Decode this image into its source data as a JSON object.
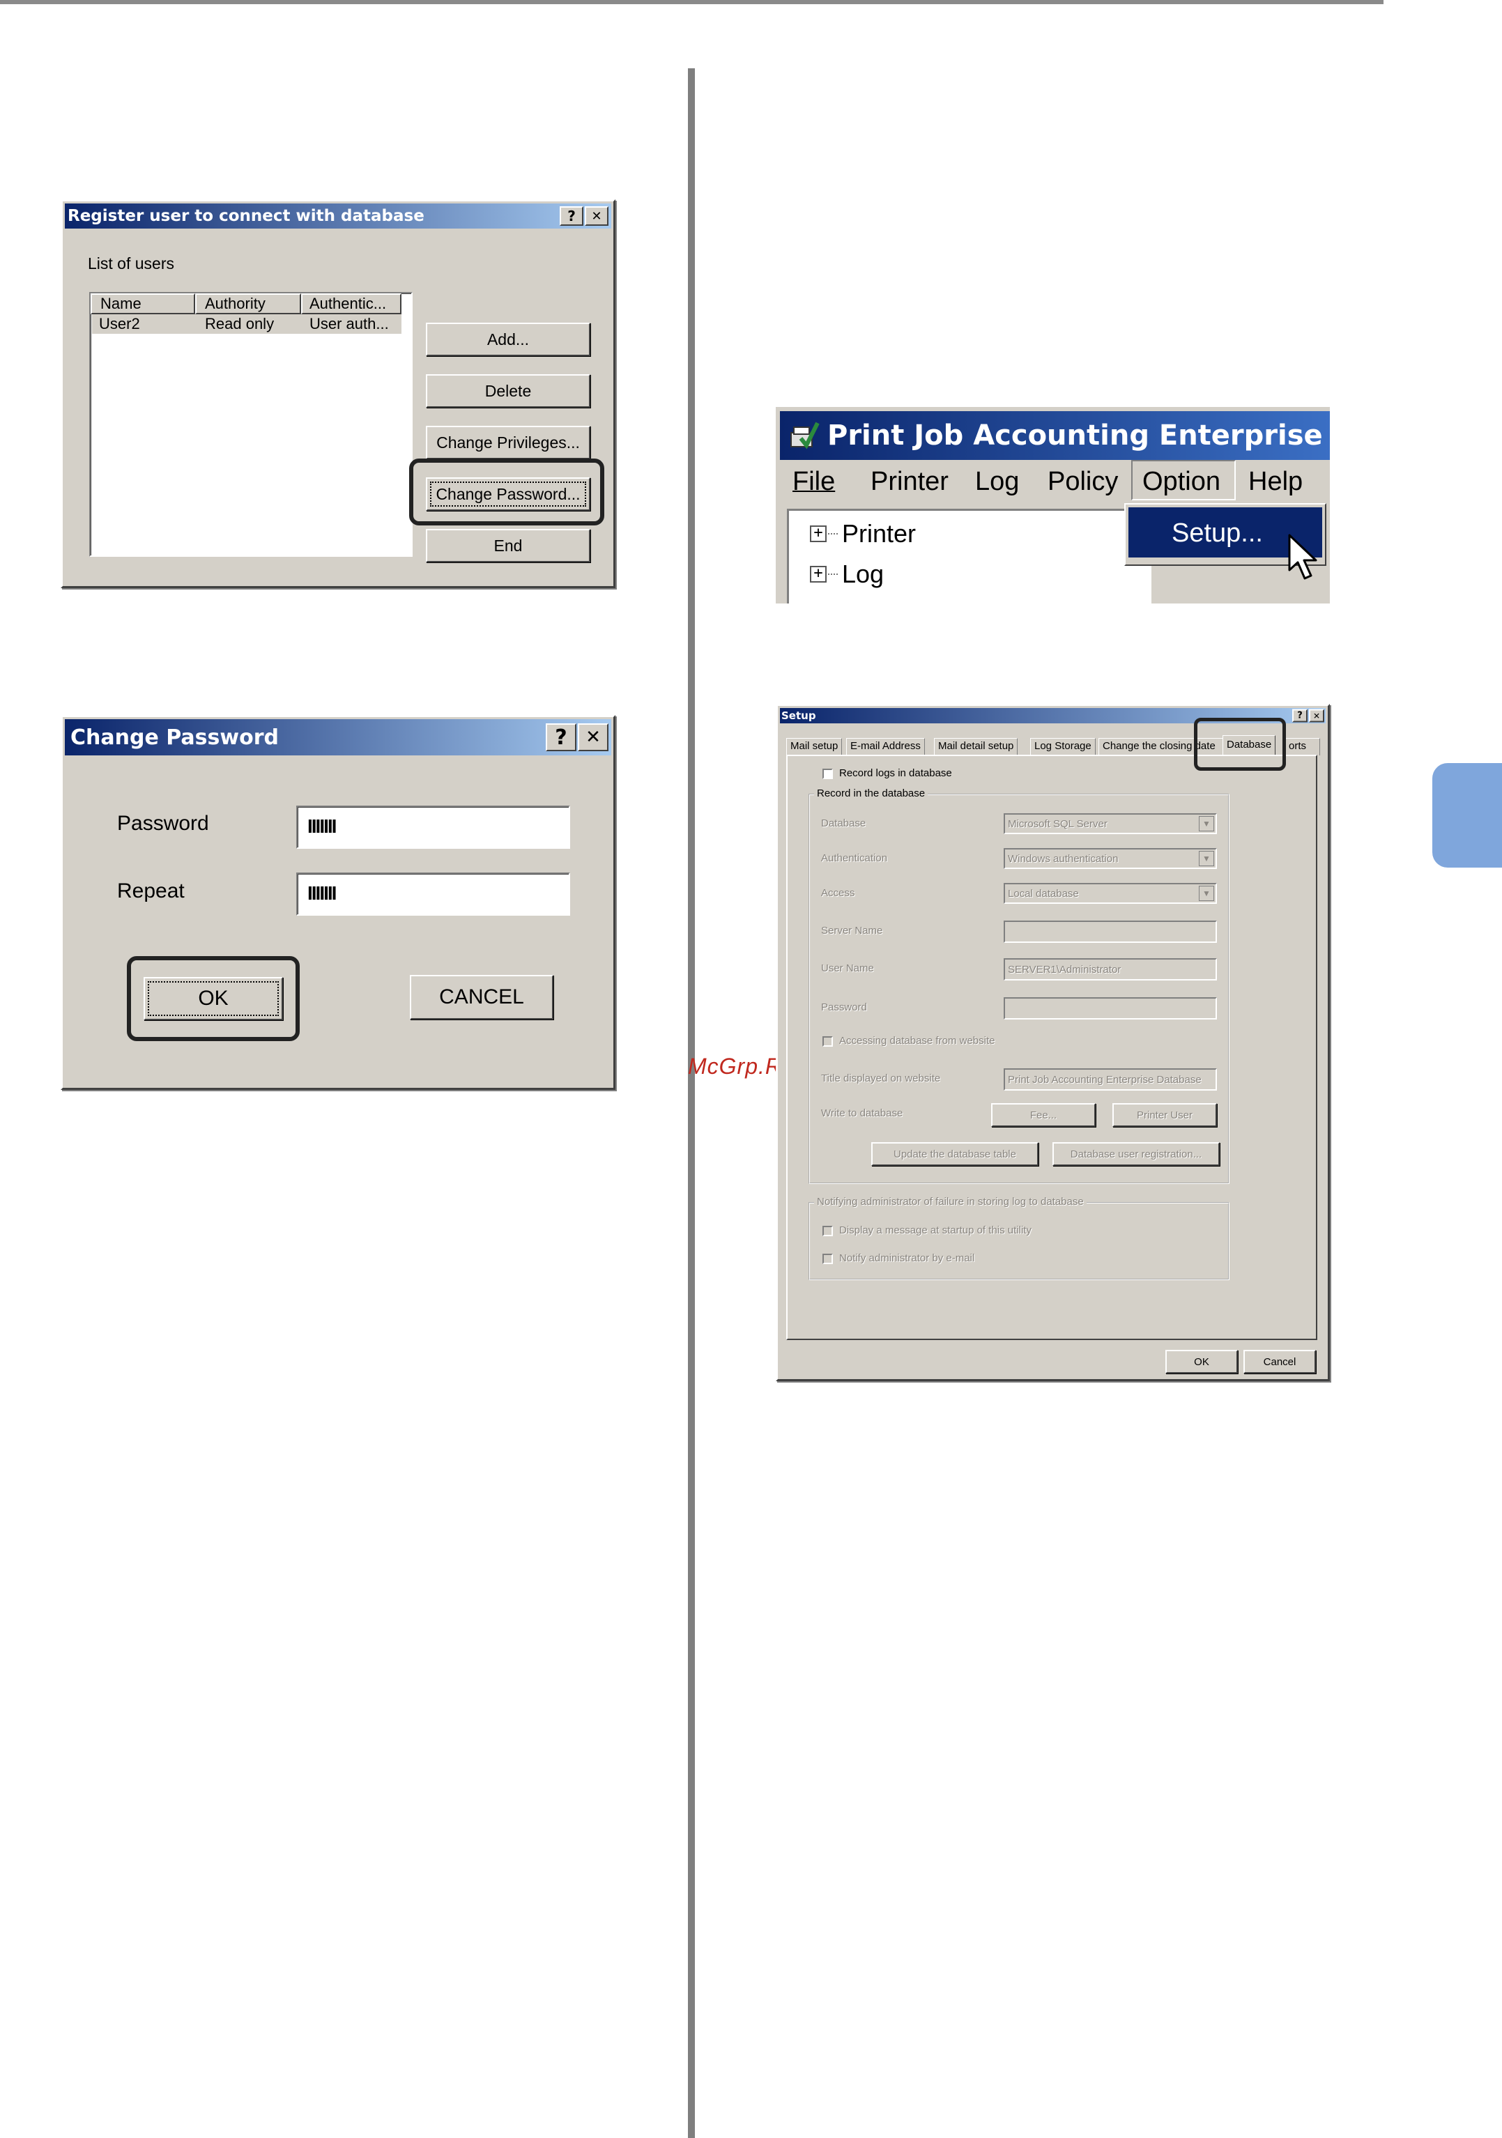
{
  "register_dialog": {
    "title": "Register user to connect with database",
    "help_glyph": "?",
    "close_glyph": "✕",
    "list_label": "List of users",
    "columns": [
      "Name",
      "Authority",
      "Authentic..."
    ],
    "rows": [
      {
        "name": "User2",
        "authority": "Read only",
        "auth": "User auth..."
      }
    ],
    "buttons": {
      "add": "Add...",
      "delete": "Delete",
      "change_privileges": "Change Privileges...",
      "change_password": "Change Password...",
      "end": "End"
    }
  },
  "change_password_dialog": {
    "title": "Change Password",
    "help_glyph": "?",
    "close_glyph": "✕",
    "password_label": "Password",
    "password_value": "IIIIIII",
    "repeat_label": "Repeat",
    "repeat_value": "IIIIIII",
    "ok": "OK",
    "cancel": "CANCEL"
  },
  "app_window": {
    "title": "Print Job Accounting Enterprise",
    "app_icon": "printer-check-icon",
    "menu": [
      "File",
      "Printer",
      "Log",
      "Policy",
      "Option",
      "Help"
    ],
    "tree": [
      "Printer",
      "Log"
    ],
    "expand_glyph": "+",
    "dropdown_item": "Setup...",
    "cursor_icon": "mouse-pointer-icon"
  },
  "setup_dialog": {
    "title": "Setup",
    "help_glyph": "?",
    "close_glyph": "✕",
    "tabs": [
      "Mail setup",
      "E-mail Address",
      "Mail detail setup",
      "Log Storage",
      "Change the closing date",
      "Database",
      "orts"
    ],
    "record_logs_label": "Record logs in database",
    "record_group_title": "Record in the database",
    "database_label": "Database",
    "database_value": "Microsoft SQL Server",
    "authentication_label": "Authentication",
    "authentication_value": "Windows authentication",
    "access_label": "Access",
    "access_value": "Local database",
    "server_name_label": "Server Name",
    "server_name_value": "",
    "user_name_label": "User Name",
    "user_name_value": "SERVER1\\Administrator",
    "password_label": "Password",
    "password_value": "",
    "accessing_web_label": "Accessing database from website",
    "title_web_label": "Title displayed on website",
    "title_web_value": "Print Job Accounting Enterprise Database",
    "write_label": "Write to database",
    "fee_button": "Fee...",
    "printer_user_button": "Printer User",
    "update_button": "Update the database table",
    "db_user_button": "Database user registration...",
    "notify_group_title": "Notifying administrator of failure in storing log to database",
    "display_msg_label": "Display a message at startup of this utility",
    "notify_email_label": "Notify administrator by e-mail",
    "ok": "OK",
    "cancel": "Cancel"
  },
  "watermark": "McGrp.Ru",
  "colors": {
    "titlebar_start": "#0a246a",
    "titlebar_end": "#a6caf0",
    "dialog_face": "#d4d0c8",
    "side_tab": "#7fa6dc",
    "highlight_border": "#222222",
    "watermark": "#c0281e"
  }
}
